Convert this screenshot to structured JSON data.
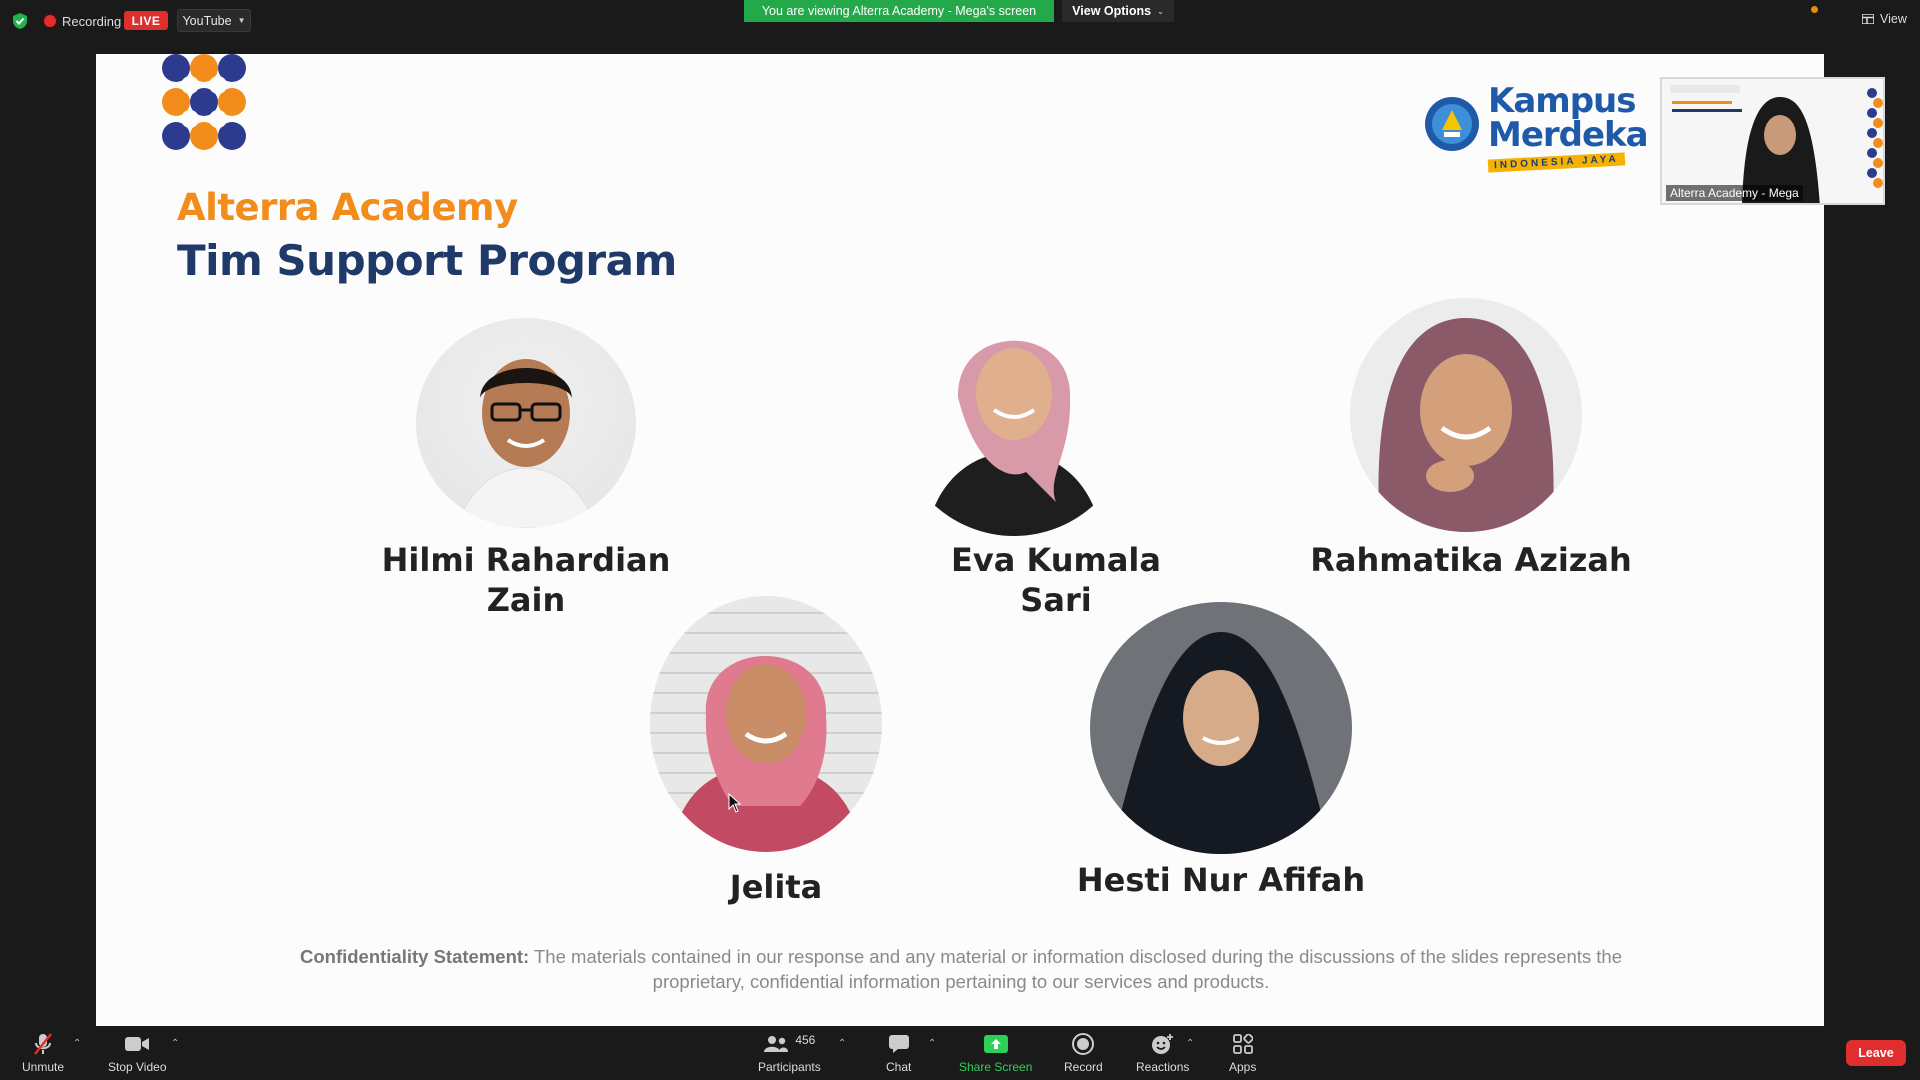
{
  "topbar": {
    "recording_label": "Recording",
    "live_label": "LIVE",
    "stream_target": "YouTube",
    "viewing_banner": "You are viewing Alterra Academy - Mega's screen",
    "view_options": "View Options",
    "view_label": "View"
  },
  "slide": {
    "title_line1": "Alterra Academy",
    "title_line2": "Tim Support Program",
    "logo_km_line1": "Kampus",
    "logo_km_line2": "Merdeka",
    "logo_km_ribbon": "INDONESIA JAYA",
    "people": [
      {
        "name_line1": "Hilmi Rahardian",
        "name_line2": "Zain"
      },
      {
        "name_line1": "Eva Kumala",
        "name_line2": "Sari"
      },
      {
        "name_line1": "Rahmatika Azizah",
        "name_line2": ""
      },
      {
        "name_line1": "Jelita",
        "name_line2": ""
      },
      {
        "name_line1": "Hesti Nur Afifah",
        "name_line2": ""
      }
    ],
    "confidential_label": "Confidentiality Statement:",
    "confidential_text": " The materials contained in our response and any material or information disclosed during the discussions of the slides represents the proprietary, confidential information pertaining to our services and products."
  },
  "thumbnail": {
    "participant_name": "Alterra Academy - Mega"
  },
  "toolbar": {
    "unmute": "Unmute",
    "stop_video": "Stop Video",
    "participants": "Participants",
    "participants_count": "456",
    "chat": "Chat",
    "share_screen": "Share Screen",
    "record": "Record",
    "reactions": "Reactions",
    "apps": "Apps",
    "leave": "Leave"
  },
  "colors": {
    "live_red": "#e02d2d",
    "banner_green": "#23a94a",
    "title_orange": "#f28c1b",
    "title_navy": "#1f3a68"
  }
}
